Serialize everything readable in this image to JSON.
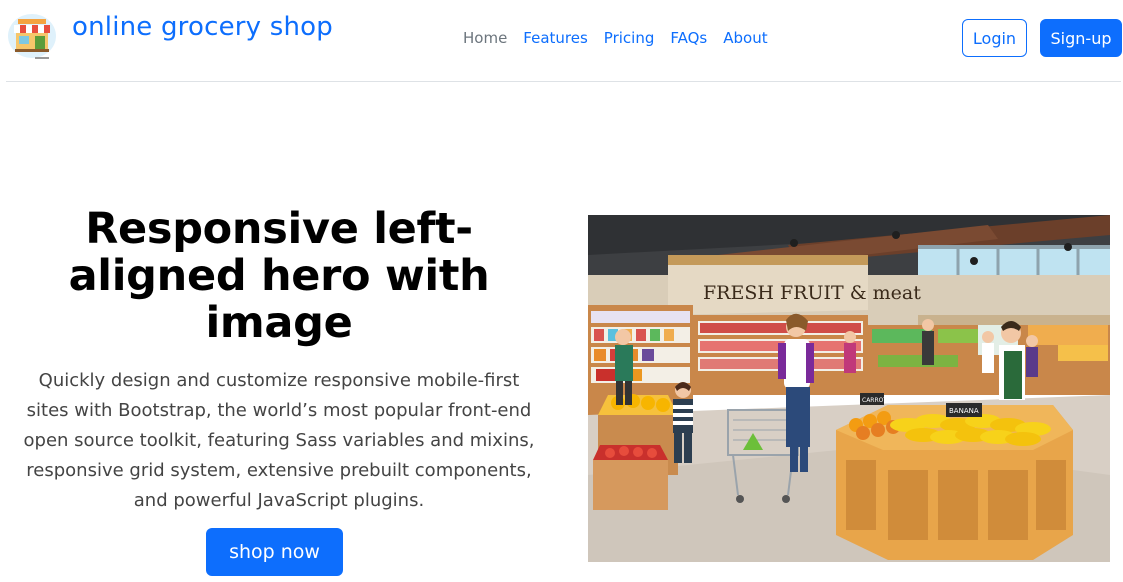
{
  "navbar": {
    "brand": "online grocery shop",
    "links": [
      {
        "label": "Home",
        "active": true
      },
      {
        "label": "Features",
        "active": false
      },
      {
        "label": "Pricing",
        "active": false
      },
      {
        "label": "FAQs",
        "active": false
      },
      {
        "label": "About",
        "active": false
      }
    ],
    "login_label": "Login",
    "signup_label": "Sign-up"
  },
  "hero": {
    "title": "Responsive left-aligned hero with image",
    "lead": "Quickly design and customize responsive mobile-first sites with Bootstrap, the world’s most popular front-end open source toolkit, featuring Sass variables and mixins, responsive grid system, extensive prebuilt components, and powerful JavaScript plugins.",
    "cta_label": "shop now",
    "image_sign": "FRESH FRUIT & meat",
    "image_labels": [
      "BANANA",
      "CARROT"
    ]
  },
  "colors": {
    "primary": "#0d6efd",
    "muted": "#6c757d"
  }
}
